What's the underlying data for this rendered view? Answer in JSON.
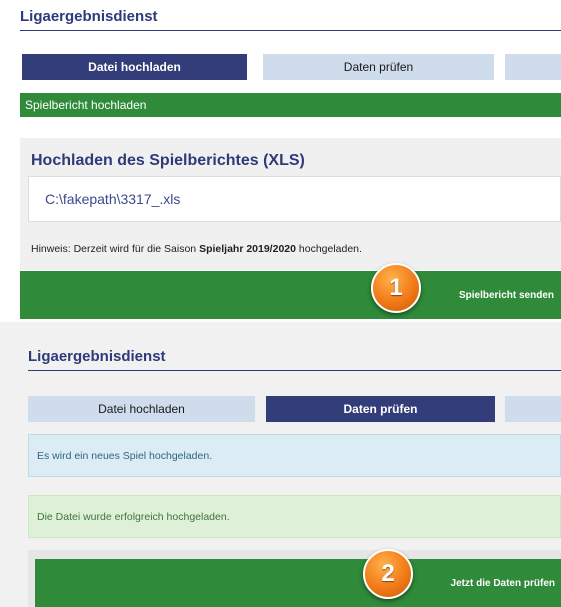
{
  "screen1": {
    "app_title": "Ligaergebnisdienst",
    "tabs": [
      {
        "label": "Datei hochladen",
        "active": true
      },
      {
        "label": "Daten prüfen",
        "active": false
      },
      {
        "label": "",
        "active": false
      }
    ],
    "section_bar": "Spielbericht hochladen",
    "card_title": "Hochladen des Spielberichtes (XLS)",
    "file_value": "C:\\fakepath\\3317_.xls",
    "hint_prefix": "Hinweis: Derzeit wird für die Saison ",
    "hint_season": "Spieljahr 2019/2020",
    "hint_suffix": " hochgeladen.",
    "submit_label": "Spielbericht senden",
    "step_number": "1"
  },
  "screen2": {
    "app_title": "Ligaergebnisdienst",
    "tabs": [
      {
        "label": "Datei hochladen",
        "active": false
      },
      {
        "label": "Daten prüfen",
        "active": true
      },
      {
        "label": "",
        "active": false
      }
    ],
    "info_message": "Es wird ein neues Spiel hochgeladen.",
    "success_message": "Die Datei wurde erfolgreich hochgeladen.",
    "check_label": "Jetzt die Daten prüfen",
    "step_number": "2"
  },
  "colors": {
    "navy": "#333d79",
    "tab_inactive": "#cfdcec",
    "green": "#2f8a3a",
    "step_orange": "#f27a18"
  }
}
